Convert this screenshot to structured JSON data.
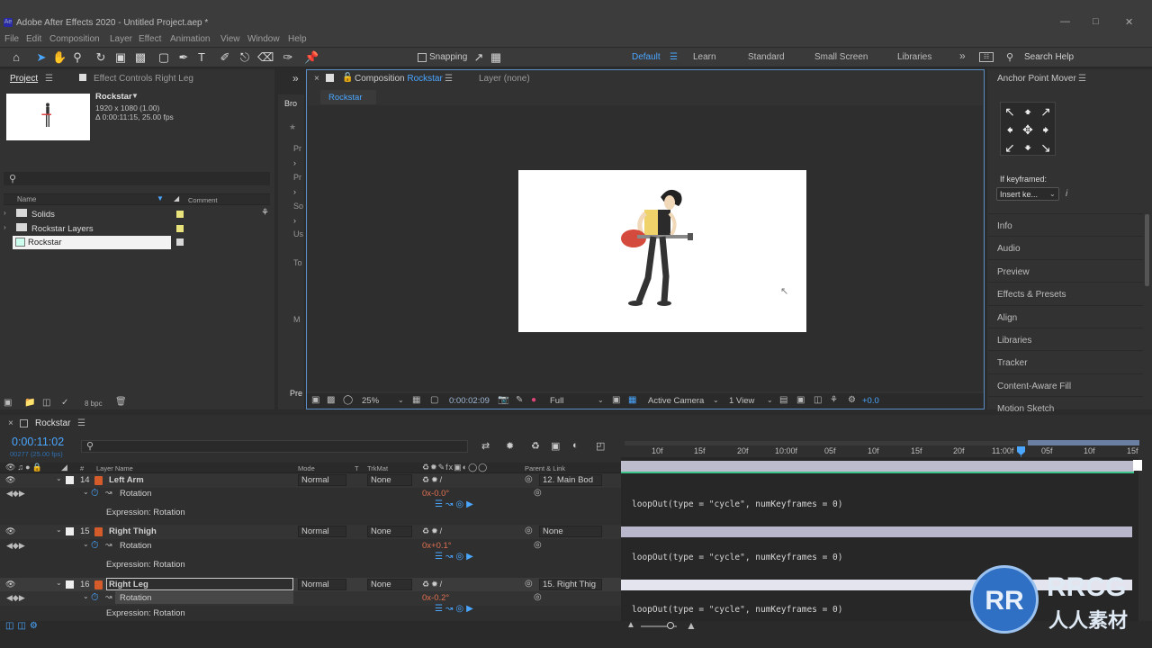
{
  "window": {
    "title": "Adobe After Effects 2020 - Untitled Project.aep *",
    "app_icon": "Ae"
  },
  "menu": [
    "File",
    "Edit",
    "Composition",
    "Layer",
    "Effect",
    "Animation",
    "View",
    "Window",
    "Help"
  ],
  "toolbar": {
    "snapping_label": "Snapping",
    "workspaces": [
      "Default",
      "Learn",
      "Standard",
      "Small Screen",
      "Libraries"
    ],
    "active_workspace": "Default",
    "search_placeholder": "Search Help",
    "accent_color": "#4aa6ff"
  },
  "project_panel": {
    "tab_label": "Project",
    "effect_controls_tab": "Effect Controls Right Leg",
    "comp_name": "Rockstar",
    "comp_info_1": "1920 x 1080 (1.00)",
    "comp_info_2": "Δ 0:00:11:15, 25.00 fps",
    "col_name": "Name",
    "col_comment": "Comment",
    "items": [
      {
        "name": "Solids",
        "label_color": "#e8e37a"
      },
      {
        "name": "Rockstar Layers",
        "label_color": "#e8e37a"
      },
      {
        "name": "Rockstar",
        "label_color": "#d8d8d8"
      }
    ],
    "bpc": "8 bpc"
  },
  "side_panel_labels": [
    "Bro",
    "Pr",
    "Pr",
    "So",
    "Us",
    "To",
    "M",
    "Pre"
  ],
  "composition_panel": {
    "tab_label": "Composition",
    "tab_comp": "Rockstar",
    "layer_tab": "Layer  (none)",
    "breadcrumb": "Rockstar",
    "zoom": "25%",
    "timecode": "0:00:02:09",
    "resolution": "Full",
    "camera": "Active Camera",
    "views": "1 View",
    "exposure": "+0.0"
  },
  "anchor_panel": {
    "title": "Anchor Point Mover",
    "if_keyframed_label": "If keyframed:",
    "keyframe_option": "Insert ke...",
    "info_glyph": "i"
  },
  "right_panels": [
    "Info",
    "Audio",
    "Preview",
    "Effects & Presets",
    "Align",
    "Libraries",
    "Tracker",
    "Content-Aware Fill",
    "Motion Sketch"
  ],
  "timeline": {
    "tab_label": "Rockstar",
    "current_time": "0:00:11:02",
    "frame_info": "00277 (25.00 fps)",
    "col_layer_name": "Layer Name",
    "col_mode": "Mode",
    "col_t": "T",
    "col_trkmat": "TrkMat",
    "col_parent": "Parent & Link",
    "ruler": [
      "10f",
      "15f",
      "20f",
      "10:00f",
      "05f",
      "10f",
      "15f",
      "20f",
      "11:00f",
      "05f",
      "10f",
      "15f"
    ],
    "layers": [
      {
        "num": "14",
        "name": "Left Arm",
        "mode": "Normal",
        "trkmat": "None",
        "parent": "12. Main Bod",
        "rotation": "0x-0.0°"
      },
      {
        "num": "15",
        "name": "Right Thigh",
        "mode": "Normal",
        "trkmat": "None",
        "parent": "None",
        "rotation": "0x+0.1°"
      },
      {
        "num": "16",
        "name": "Right Leg",
        "mode": "Normal",
        "trkmat": "None",
        "parent": "15. Right Thig",
        "rotation": "0x-0.2°"
      }
    ],
    "property_label": "Rotation",
    "expression_label": "Expression: Rotation",
    "expression_code": "loopOut(type = \"cycle\", numKeyframes = 0)"
  },
  "watermark": {
    "text_1": "RRCG",
    "text_2": "人人素材"
  }
}
